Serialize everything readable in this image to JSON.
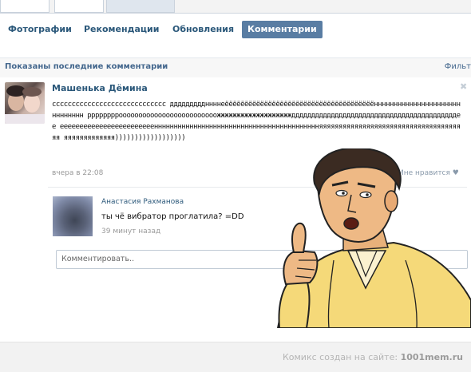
{
  "nav": {
    "items": [
      "Фотографии",
      "Рекомендации",
      "Обновления",
      "Комментарии"
    ],
    "active_index": 3
  },
  "header": {
    "title": "Показаны последние комментарии",
    "filter": "Фильт"
  },
  "post": {
    "author": "Машенька Дёмина",
    "text": "ccccccccccccccccccccccccccccc дддддддддннннеёёёёёёёёёёёёёёёёёёёёёёёёёёёёёёёёёёёёёённнннннннннннннннннннннннннннн ррррррррооооооооооооооооооооооооожжжжжжжжжжжжжжжжжжжддддддддддддддддддддддддддддддддддддддддддее еееееееееееееееееееееееенннннннннннннннннннннннннннннннннннннннннняяяяяяяяяяяяяяяяяяяяяяяяяяяяяяяяяяяяяя яяяяяяяяяяяяя))))))))))))))))))",
    "time": "вчера в 22:08",
    "like_label": "Мне нравится",
    "close_glyph": "✖"
  },
  "reply": {
    "author": "Анастасия Рахманова",
    "text": "ты чё вибратор проглатила? =DD",
    "time": "39 минут назад"
  },
  "comment_input": {
    "placeholder": "Комментировать.."
  },
  "footer": {
    "label": "Комикс создан на сайте:",
    "site": "1001mem.ru"
  }
}
